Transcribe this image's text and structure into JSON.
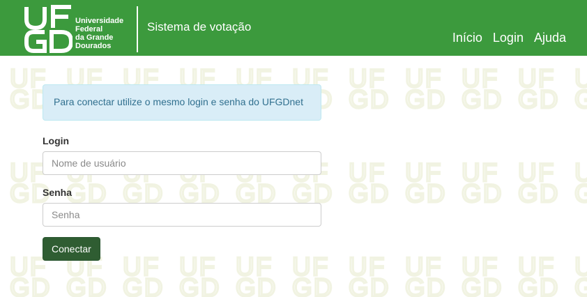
{
  "header": {
    "logo_letters": "UFGD",
    "institution_lines": [
      "Universidade",
      "Federal",
      "da Grande",
      "Dourados"
    ],
    "system_title": "Sistema de votação",
    "nav": [
      {
        "label": "Início"
      },
      {
        "label": "Login"
      },
      {
        "label": "Ajuda"
      }
    ]
  },
  "alert": {
    "text": "Para conectar utilize o mesmo login e senha do UFGDnet"
  },
  "form": {
    "login_label": "Login",
    "login_placeholder": "Nome de usuário",
    "login_value": "",
    "password_label": "Senha",
    "password_placeholder": "Senha",
    "password_value": "",
    "submit_label": "Conectar"
  },
  "colors": {
    "header_bg": "#3c9a3d",
    "button_bg": "#2f5d32",
    "alert_bg": "#d9edf7",
    "alert_text": "#31708f",
    "watermark": "#f1f3e2"
  },
  "icons": {
    "logo": "ufgd-logo-icon"
  }
}
